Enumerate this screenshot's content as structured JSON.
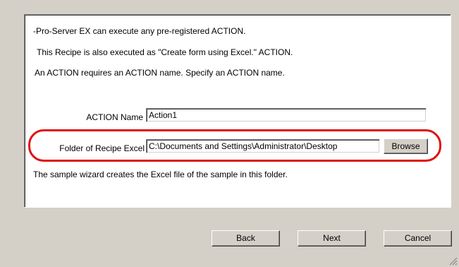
{
  "panel": {
    "line1": "-Pro-Server EX can execute any pre-registered ACTION.",
    "line2": "This Recipe is also executed as \"Create form using Excel.\" ACTION.",
    "line3": "An ACTION requires an ACTION  name. Specify an ACTION name.",
    "action_name_label": "ACTION Name",
    "action_name_value": "Action1",
    "folder_label": "Folder of Recipe Excel",
    "folder_value": "C:\\Documents and Settings\\Administrator\\Desktop",
    "browse_label": "Browse",
    "note": "The sample wizard creates the Excel file of the sample in this folder."
  },
  "buttons": {
    "back": "Back",
    "next": "Next",
    "cancel": "Cancel"
  },
  "colors": {
    "highlight": "#e01010",
    "dialog_bg": "#d4d0c8"
  },
  "icons": {
    "resize_grip": "resize-grip-icon"
  }
}
